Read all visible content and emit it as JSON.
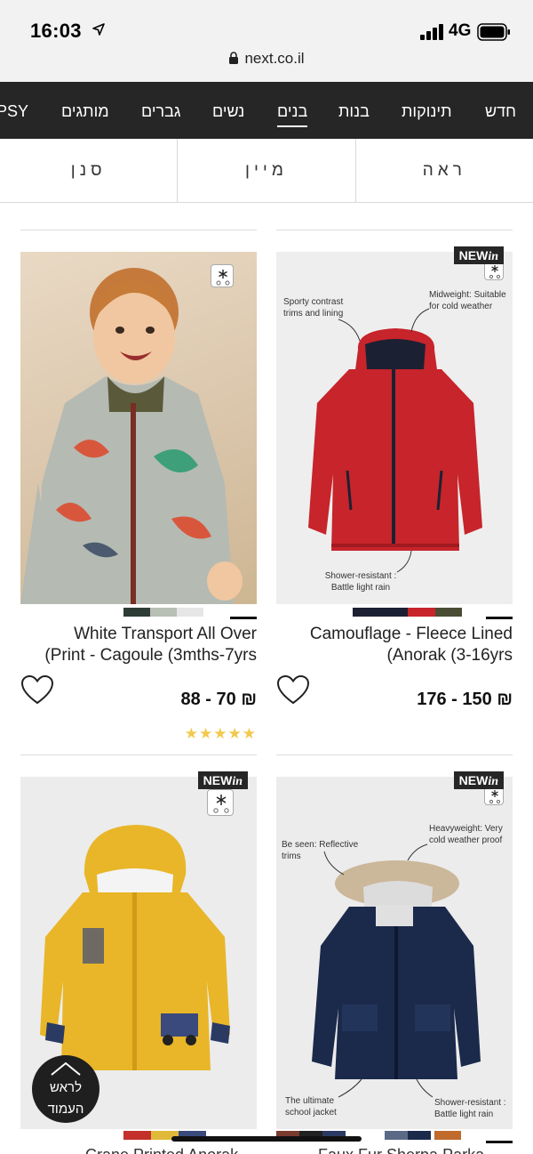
{
  "status": {
    "time": "16:03",
    "network": "4G"
  },
  "browser": {
    "url": "next.co.il"
  },
  "nav": {
    "items": [
      {
        "label": "חדש"
      },
      {
        "label": "תינוקות"
      },
      {
        "label": "בנות"
      },
      {
        "label": "בנים",
        "active": true
      },
      {
        "label": "נשים"
      },
      {
        "label": "גברים"
      },
      {
        "label": "מותגים"
      },
      {
        "label": "PSY"
      }
    ]
  },
  "filters": {
    "view": "ראה",
    "sort": "מיין",
    "filter": "סנן"
  },
  "products": [
    {
      "title_line1": "Camouflage - Fleece Lined",
      "title_line2": "(Anorak (3-16yrs",
      "price": "176 - 150 ₪",
      "new_label": "NEW",
      "new_label_italic": "in",
      "annotations": [
        "Sporty contrast trims and lining",
        "Midweight: Suitable for cold weather",
        "Shower-resistant : Battle light rain"
      ],
      "swatch_colors": [
        "#1c2033",
        "#1c2033",
        "#c7242b",
        "#4a4d33"
      ]
    },
    {
      "title_line1": "White Transport All Over",
      "title_line2": "(Print - Cagoule (3mths-7yrs",
      "price": "88 - 70 ₪",
      "rating": "★★★★★",
      "swatch_colors": [
        "#2d3d35",
        "#b8bfb4",
        "#ffffff"
      ]
    },
    {
      "new_label": "NEW",
      "new_label_italic": "in",
      "annotations": [
        "Be seen: Reflective trims",
        "Heavyweight: Very cold weather proof",
        "The ultimate school jacket",
        "Shower-resistant : Battle light rain"
      ],
      "swatch_colors": [
        "#7a3b2e",
        "#222222",
        "#2a3a63",
        "#5a6a86",
        "#1b2a4b",
        "#c06a2c"
      ]
    },
    {
      "new_label": "NEW",
      "new_label_italic": "in",
      "swatch_colors": [
        "#c4302b",
        "#e1b93a",
        "#3a4a7c",
        "#1b2a4b"
      ]
    }
  ],
  "partial_titles": {
    "left": "Crane Printed Anorak",
    "right": "Faux Fur Sherpa Parka"
  },
  "back_to_top": {
    "line1": "לראש",
    "line2": "העמוד"
  }
}
